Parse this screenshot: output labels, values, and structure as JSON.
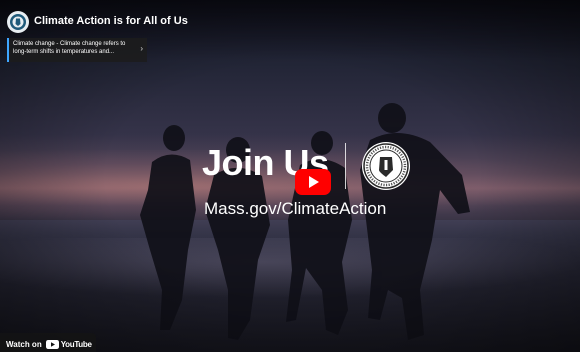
{
  "video": {
    "title": "Climate Action is for All of Us",
    "channel_avatar_icon": "massachusetts-seal-icon",
    "info_card_text": "Climate change - Climate change refers to long-term shifts in temperatures and...",
    "overlay_headline": "Join Us",
    "overlay_url": "Mass.gov/ClimateAction",
    "play_button_color": "#ff0000"
  },
  "footer": {
    "watch_on_label": "Watch on",
    "youtube_wordmark": "YouTube"
  }
}
